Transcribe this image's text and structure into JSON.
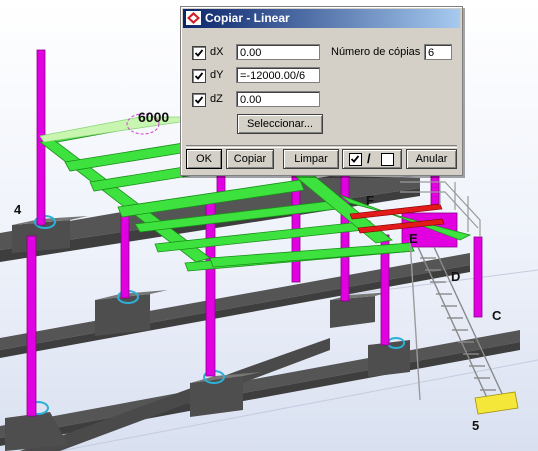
{
  "viewport": {
    "labels": {
      "dimension": "6000",
      "grid_4": "4",
      "grid_F": "F",
      "grid_E": "E",
      "grid_D": "D",
      "grid_C": "C",
      "grid_5": "5"
    }
  },
  "dialog": {
    "title": "Copiar - Linear",
    "icon": "app-logo-icon",
    "rows": [
      {
        "label": "dX",
        "checked": true,
        "value": "0.00"
      },
      {
        "label": "dY",
        "checked": true,
        "value": "=-12000.00/6"
      },
      {
        "label": "dZ",
        "checked": true,
        "value": "0.00"
      }
    ],
    "num_copies_label": "Número de cópias",
    "num_copies_value": "6",
    "select_button": "Seleccionar...",
    "buttons": {
      "ok": "OK",
      "copy": "Copiar",
      "clear": "Limpar",
      "toggle_separator": "/",
      "cancel": "Anular"
    }
  }
}
